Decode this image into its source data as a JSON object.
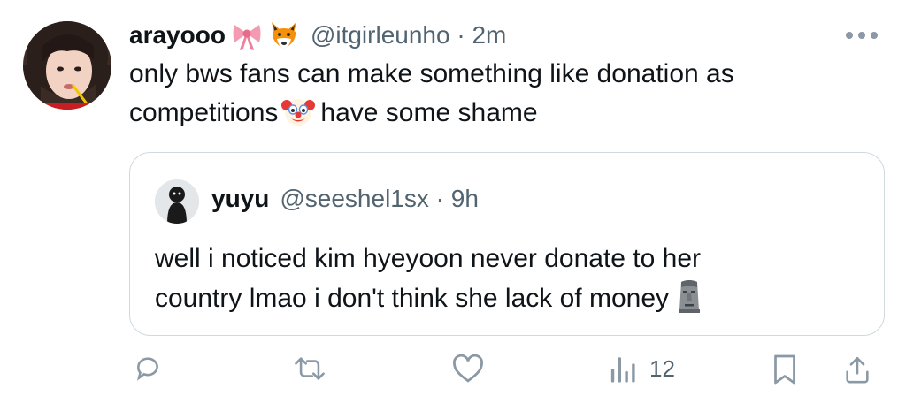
{
  "tweet": {
    "display_name": "arayooo",
    "handle": "@itgirleunho",
    "separator": "·",
    "time": "2m",
    "text_line1": "only bws fans can make something like donation as",
    "text_line2_before": "competitions",
    "text_line2_after": "have some shame",
    "name_emojis": [
      "ribbon-icon",
      "fox-face-icon"
    ],
    "inline_emoji": "clown-face-icon"
  },
  "quote": {
    "display_name": "yuyu",
    "handle": "@seeshel1sx",
    "separator": "·",
    "time": "9h",
    "text_line1": "well i noticed kim hyeyoon never donate to her",
    "text_line2": "country lmao i don't think she lack of money",
    "inline_emoji": "moai-icon"
  },
  "actions": {
    "views_count": "12",
    "icons": [
      "reply-icon",
      "retweet-icon",
      "like-icon",
      "views-icon",
      "bookmark-icon",
      "share-icon"
    ]
  },
  "colors": {
    "text": "#0f1419",
    "muted": "#536471",
    "icon": "#8b98a5",
    "border": "#cfd9de"
  }
}
